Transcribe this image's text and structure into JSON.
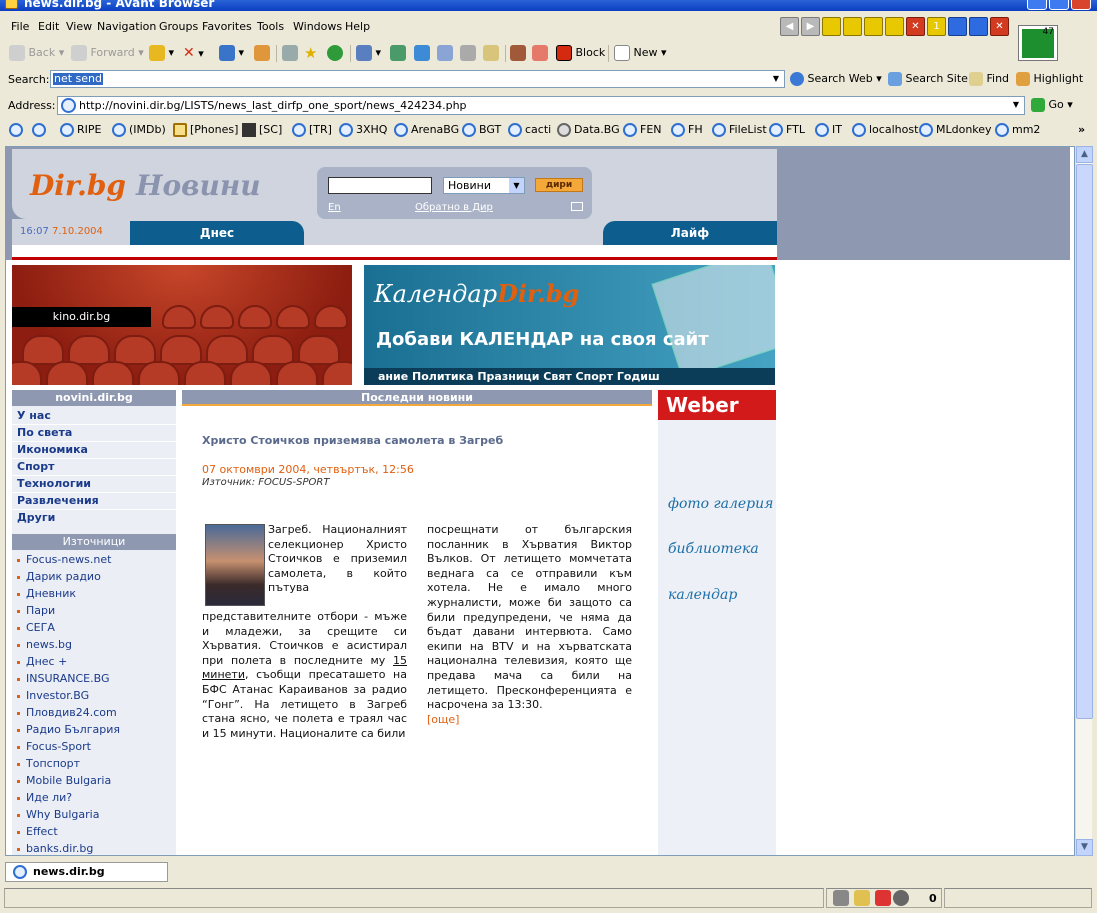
{
  "window": {
    "title": "news.dir.bg - Avant Browser"
  },
  "menu": [
    "File",
    "Edit",
    "View",
    "Navigation",
    "Groups",
    "Favorites",
    "Tools",
    "Windows",
    "Help"
  ],
  "tab_controls": [
    "1"
  ],
  "cpu_meter": "47",
  "toolbar": {
    "back": "Back",
    "forward": "Forward",
    "block": "Block",
    "new": "New"
  },
  "search": {
    "label": "Search:",
    "value": "net send",
    "search_web": "Search Web",
    "search_site": "Search Site",
    "find": "Find",
    "highlight": "Highlight"
  },
  "address": {
    "label": "Address:",
    "url": "http://novini.dir.bg/LISTS/news_last_dirfp_one_sport/news_424234.php",
    "go": "Go"
  },
  "links": [
    "RIPE",
    "(IMDb)",
    "[Phones]",
    "[SC]",
    "[TR]",
    "3XHQ",
    "ArenaBG",
    "BGT",
    "cacti",
    "Data.BG",
    "FEN",
    "FH",
    "FileList",
    "FTL",
    "IT",
    "localhost",
    "MLdonkey",
    "mm2"
  ],
  "page": {
    "logo_dir": "Dir.bg",
    "logo_news": "Новини",
    "search_select": "Новини",
    "search_button": "дири",
    "link_en": "En",
    "link_back": "Обратно в Дир",
    "time": "16:07",
    "date": "7.10.2004",
    "tab_today": "Днес",
    "tab_life": "Лайф",
    "banner_kino": "kino.dir.bg",
    "banner_calendar_title": "Календар",
    "banner_calendar_dir": "Dir.bg",
    "banner_calendar_text": "Добави КАЛЕНДАР на своя сайт",
    "banner_calendar_cats": "ание  Политика  Празници  Свят  Спорт  Годиш",
    "nav_header": "novini.dir.bg",
    "nav_items": [
      "У нас",
      "По света",
      "Икономика",
      "Спорт",
      "Технологии",
      "Развлечения",
      "Други"
    ],
    "sources_header": "Източници",
    "sources": [
      "Focus-news.net",
      "Дарик радио",
      "Дневник",
      "Пари",
      "СЕГА",
      "news.bg",
      "Днес +",
      "INSURANCE.BG",
      "Investor.BG",
      "Пловдив24.com",
      "Радио България",
      "Focus-Sport",
      "Топспорт",
      "Mobile Bulgaria",
      "Иде ли?",
      "Why Bulgaria",
      "Effect",
      "banks.dir.bg"
    ],
    "latest_header": "Последни новини",
    "article": {
      "title": "Христо Стоичков приземява самолета в Загреб",
      "date": "07 октомври 2004, четвъртък, 12:56",
      "source": "Източник: FOCUS-SPORT",
      "col1a": "Загреб. Националният селекционер Христо Стоичков е приземил самолета, в който пътува",
      "col1b_pre": "представителните отбори - мъже и младежи, за срещите си Хърватия. Стоичков е асистирал при полета в последните му ",
      "col1b_link": "15 минети",
      "col1b_post": ", съобщи пресаташето на БФС Атанас Караиванов за радио “Гонг”. На летището в Загреб стана ясно, че полета е траял час и 15 минути. Националите са били",
      "col2": "посрещнати от българския посланник в Хърватия Виктор Вълков. От летището момчетата веднага са се отправили към хотела. Не е имало много журналисти, може би защото са били предупредени, че няма да бъдат давани интервюта. Само екипи на BTV и на хърватската национална телевизия, която ще предава мача са били на летището. Пресконференцията е насрочена за 13:30.",
      "more": "[още]"
    },
    "right_banner": "Weber",
    "right_links": [
      "фото галерия",
      "библиотека",
      "календар"
    ]
  },
  "tabbar": {
    "tab": "news.dir.bg"
  },
  "status": {
    "count": "0"
  }
}
